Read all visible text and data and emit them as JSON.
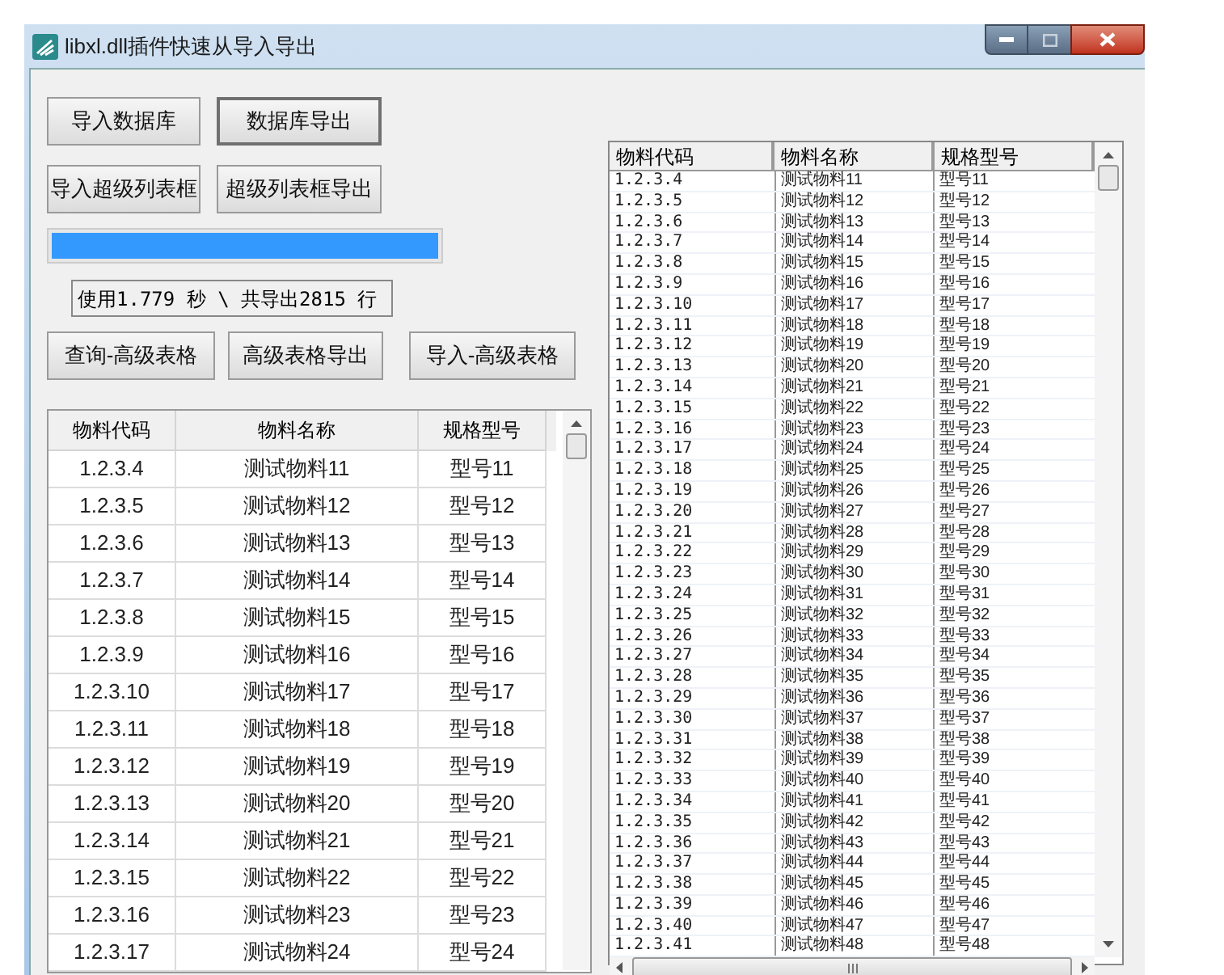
{
  "window": {
    "title": "libxl.dll插件快速从导入导出"
  },
  "button_rows": [
    [
      {
        "label": "导入数据库",
        "focused": false
      },
      {
        "label": "数据库导出",
        "focused": true
      }
    ],
    [
      {
        "label": "导入超级列表框",
        "focused": false
      },
      {
        "label": "超级列表框导出",
        "focused": false
      }
    ]
  ],
  "progress": {
    "level": 1
  },
  "status": "使用1.779 秒 \\ 共导出2815 行",
  "grid_buttons": [
    {
      "label": "查询-高级表格",
      "focused": false
    },
    {
      "label": "高级表格导出",
      "focused": false
    },
    {
      "label": "导入-高级表格",
      "focused": false
    }
  ],
  "grid": {
    "columns": [
      "物料代码",
      "物料名称",
      "规格型号"
    ],
    "rows": [
      [
        "1.2.3.4",
        "测试物料11",
        "型号11"
      ],
      [
        "1.2.3.5",
        "测试物料12",
        "型号12"
      ],
      [
        "1.2.3.6",
        "测试物料13",
        "型号13"
      ],
      [
        "1.2.3.7",
        "测试物料14",
        "型号14"
      ],
      [
        "1.2.3.8",
        "测试物料15",
        "型号15"
      ],
      [
        "1.2.3.9",
        "测试物料16",
        "型号16"
      ],
      [
        "1.2.3.10",
        "测试物料17",
        "型号17"
      ],
      [
        "1.2.3.11",
        "测试物料18",
        "型号18"
      ],
      [
        "1.2.3.12",
        "测试物料19",
        "型号19"
      ],
      [
        "1.2.3.13",
        "测试物料20",
        "型号20"
      ],
      [
        "1.2.3.14",
        "测试物料21",
        "型号21"
      ],
      [
        "1.2.3.15",
        "测试物料22",
        "型号22"
      ],
      [
        "1.2.3.16",
        "测试物料23",
        "型号23"
      ],
      [
        "1.2.3.17",
        "测试物料24",
        "型号24"
      ]
    ]
  },
  "list": {
    "columns": [
      "物料代码",
      "物料名称",
      "规格型号"
    ],
    "rows": [
      [
        "1.2.3.4",
        "测试物料11",
        "型号11"
      ],
      [
        "1.2.3.5",
        "测试物料12",
        "型号12"
      ],
      [
        "1.2.3.6",
        "测试物料13",
        "型号13"
      ],
      [
        "1.2.3.7",
        "测试物料14",
        "型号14"
      ],
      [
        "1.2.3.8",
        "测试物料15",
        "型号15"
      ],
      [
        "1.2.3.9",
        "测试物料16",
        "型号16"
      ],
      [
        "1.2.3.10",
        "测试物料17",
        "型号17"
      ],
      [
        "1.2.3.11",
        "测试物料18",
        "型号18"
      ],
      [
        "1.2.3.12",
        "测试物料19",
        "型号19"
      ],
      [
        "1.2.3.13",
        "测试物料20",
        "型号20"
      ],
      [
        "1.2.3.14",
        "测试物料21",
        "型号21"
      ],
      [
        "1.2.3.15",
        "测试物料22",
        "型号22"
      ],
      [
        "1.2.3.16",
        "测试物料23",
        "型号23"
      ],
      [
        "1.2.3.17",
        "测试物料24",
        "型号24"
      ],
      [
        "1.2.3.18",
        "测试物料25",
        "型号25"
      ],
      [
        "1.2.3.19",
        "测试物料26",
        "型号26"
      ],
      [
        "1.2.3.20",
        "测试物料27",
        "型号27"
      ],
      [
        "1.2.3.21",
        "测试物料28",
        "型号28"
      ],
      [
        "1.2.3.22",
        "测试物料29",
        "型号29"
      ],
      [
        "1.2.3.23",
        "测试物料30",
        "型号30"
      ],
      [
        "1.2.3.24",
        "测试物料31",
        "型号31"
      ],
      [
        "1.2.3.25",
        "测试物料32",
        "型号32"
      ],
      [
        "1.2.3.26",
        "测试物料33",
        "型号33"
      ],
      [
        "1.2.3.27",
        "测试物料34",
        "型号34"
      ],
      [
        "1.2.3.28",
        "测试物料35",
        "型号35"
      ],
      [
        "1.2.3.29",
        "测试物料36",
        "型号36"
      ],
      [
        "1.2.3.30",
        "测试物料37",
        "型号37"
      ],
      [
        "1.2.3.31",
        "测试物料38",
        "型号38"
      ],
      [
        "1.2.3.32",
        "测试物料39",
        "型号39"
      ],
      [
        "1.2.3.33",
        "测试物料40",
        "型号40"
      ],
      [
        "1.2.3.34",
        "测试物料41",
        "型号41"
      ],
      [
        "1.2.3.35",
        "测试物料42",
        "型号42"
      ],
      [
        "1.2.3.36",
        "测试物料43",
        "型号43"
      ],
      [
        "1.2.3.37",
        "测试物料44",
        "型号44"
      ],
      [
        "1.2.3.38",
        "测试物料45",
        "型号45"
      ],
      [
        "1.2.3.39",
        "测试物料46",
        "型号46"
      ],
      [
        "1.2.3.40",
        "测试物料47",
        "型号47"
      ],
      [
        "1.2.3.41",
        "测试物料48",
        "型号48"
      ]
    ]
  }
}
